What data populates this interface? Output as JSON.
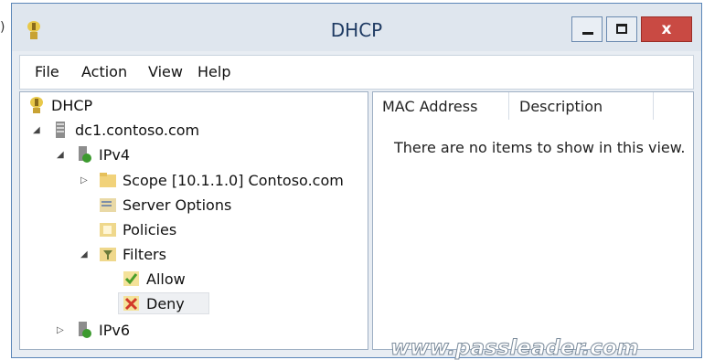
{
  "stray_char": ")",
  "window": {
    "title": "DHCP",
    "minimize_icon": "minimize-icon",
    "maximize_icon": "maximize-icon",
    "close_icon": "close-icon",
    "close_glyph": "x"
  },
  "menu": [
    "File",
    "Action",
    "View",
    "Help"
  ],
  "tree": {
    "root": "DHCP",
    "server": "dc1.contoso.com",
    "ipv4": "IPv4",
    "scope": "Scope [10.1.1.0] Contoso.com",
    "server_options": "Server Options",
    "policies": "Policies",
    "filters": "Filters",
    "allow": "Allow",
    "deny": "Deny",
    "ipv6": "IPv6",
    "selected": "Deny"
  },
  "list": {
    "columns": [
      "MAC Address",
      "Description"
    ],
    "empty_message": "There are no items to show in this view."
  },
  "watermark": "www.passleader.com",
  "colors": {
    "accent": "#5b86b8",
    "close": "#c94a43",
    "selection": "#eef0f3"
  }
}
